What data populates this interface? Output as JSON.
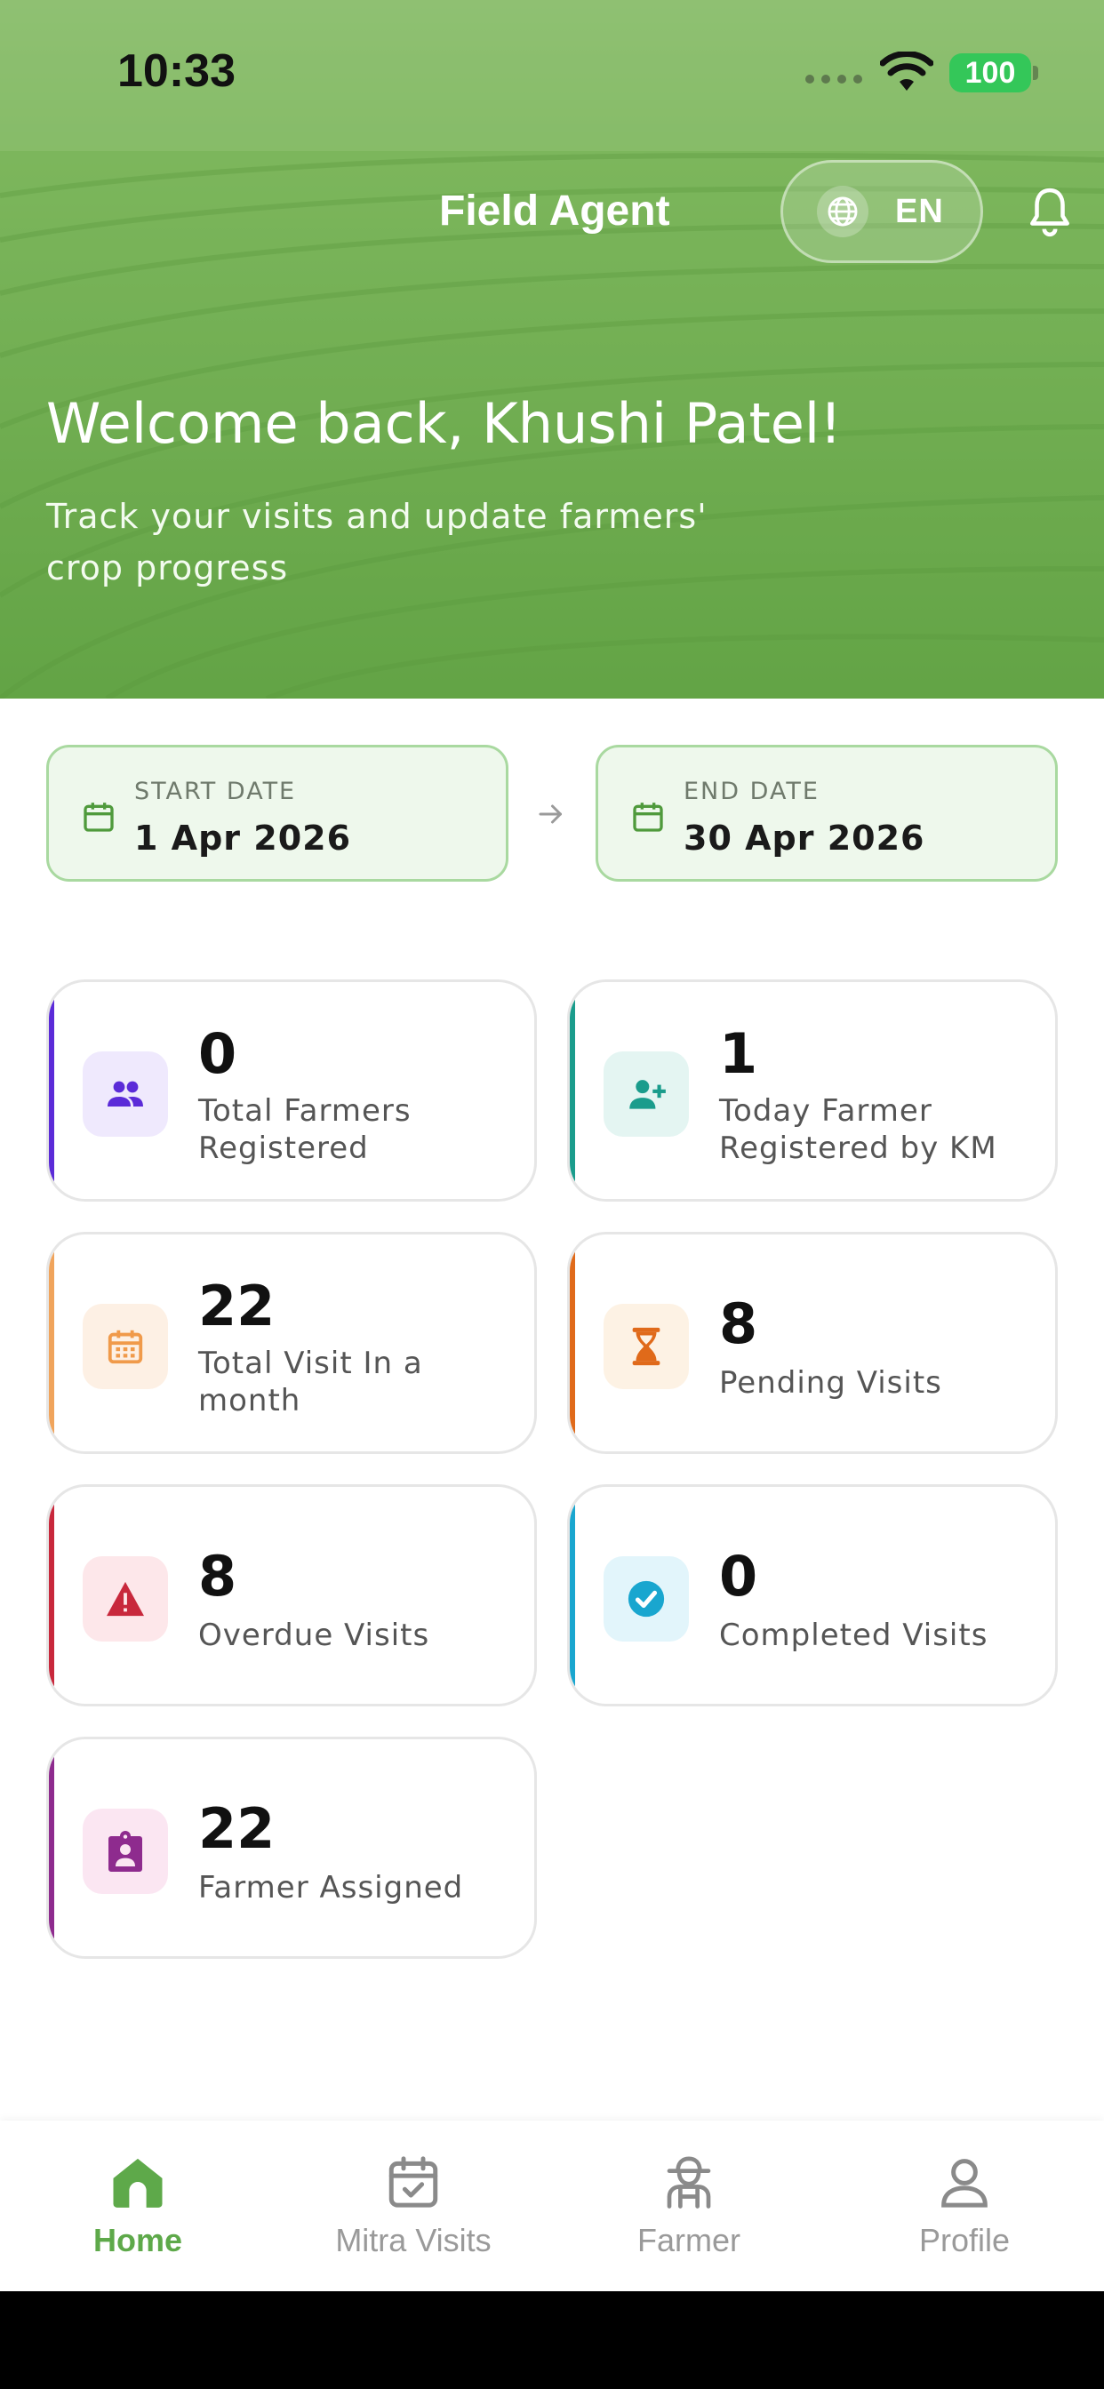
{
  "status_bar": {
    "time": "10:33",
    "battery": "100"
  },
  "header": {
    "title": "Field Agent",
    "language": "EN",
    "welcome": "Welcome back, Khushi Patel!",
    "subtitle": "Track your visits and update farmers' crop progress"
  },
  "dates": {
    "start_label": "START DATE",
    "start_value": "1 Apr 2026",
    "end_label": "END DATE",
    "end_value": "30 Apr 2026"
  },
  "stats": [
    {
      "value": "0",
      "label": "Total Farmers Registered",
      "icon": "people-icon",
      "accent": "#5b2bd8",
      "icon_bg": "#efe9fd"
    },
    {
      "value": "1",
      "label": "Today Farmer Registered by KM",
      "icon": "person-add-icon",
      "accent": "#1a9c8c",
      "icon_bg": "#e4f5f2"
    },
    {
      "value": "22",
      "label": "Total Visit In a month",
      "icon": "calendar-icon",
      "accent": "#f0a45c",
      "icon_bg": "#fdf0e4"
    },
    {
      "value": "8",
      "label": "Pending Visits",
      "icon": "hourglass-icon",
      "accent": "#e06a1a",
      "icon_bg": "#fdf2e4"
    },
    {
      "value": "8",
      "label": "Overdue Visits",
      "icon": "warning-icon",
      "accent": "#c8283c",
      "icon_bg": "#fde7ea"
    },
    {
      "value": "0",
      "label": "Completed Visits",
      "icon": "check-circle-icon",
      "accent": "#19a6cf",
      "icon_bg": "#e2f5fb"
    },
    {
      "value": "22",
      "label": "Farmer Assigned",
      "icon": "assignment-ind-icon",
      "accent": "#8e2b8e",
      "icon_bg": "#fbe6f2"
    }
  ],
  "nav": [
    {
      "label": "Home",
      "icon": "home-icon",
      "active": true
    },
    {
      "label": "Mitra Visits",
      "icon": "calendar-check-icon",
      "active": false
    },
    {
      "label": "Farmer",
      "icon": "farmer-icon",
      "active": false
    },
    {
      "label": "Profile",
      "icon": "profile-icon",
      "active": false
    }
  ],
  "colors": {
    "brand_green": "#5ea94a",
    "date_bg": "#eef8ec",
    "date_border": "#a9d9a0"
  }
}
